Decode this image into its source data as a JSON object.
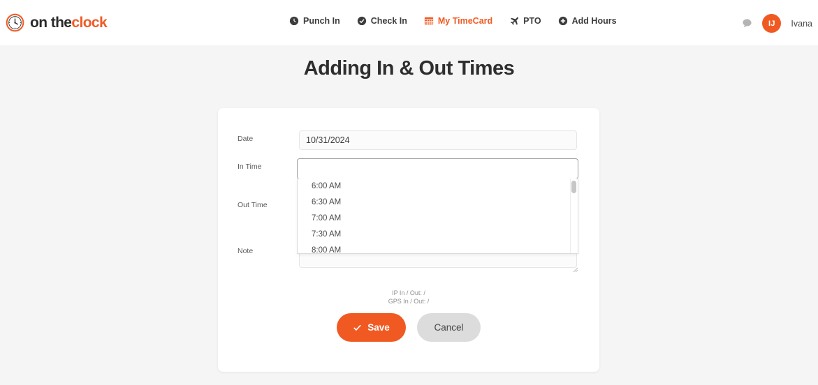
{
  "brand": {
    "icon": "clock-icon",
    "text_dark": "on the",
    "text_accent": "clock",
    "accent_color": "#ef5b25"
  },
  "nav": {
    "items": [
      {
        "label": "Punch In",
        "icon": "clock-icon",
        "active": false
      },
      {
        "label": "Check In",
        "icon": "check-circle-icon",
        "active": false
      },
      {
        "label": "My TimeCard",
        "icon": "table-grid-icon",
        "active": true
      },
      {
        "label": "PTO",
        "icon": "airplane-icon",
        "active": false
      },
      {
        "label": "Add Hours",
        "icon": "plus-circle-icon",
        "active": false
      }
    ]
  },
  "account": {
    "notification_icon": "chat-bubble-icon",
    "avatar_initials": "IJ",
    "avatar_color": "#f05a22",
    "user_name": "Ivana"
  },
  "page": {
    "title": "Adding In & Out Times"
  },
  "form": {
    "date": {
      "label": "Date",
      "value": "10/31/2024",
      "placeholder": ""
    },
    "in_time": {
      "label": "In Time",
      "value": "",
      "placeholder": "",
      "focused": true
    },
    "out_time": {
      "label": "Out Time",
      "value": "",
      "placeholder": ""
    },
    "note": {
      "label": "Note",
      "value": "",
      "placeholder": ""
    }
  },
  "time_dropdown": {
    "open": true,
    "options": [
      "6:00 AM",
      "6:30 AM",
      "7:00 AM",
      "7:30 AM",
      "8:00 AM"
    ]
  },
  "meta": {
    "ip_line": "IP In / Out:  /",
    "gps_line": "GPS In / Out:  /"
  },
  "buttons": {
    "save": "Save",
    "save_icon": "check-icon",
    "save_color": "#f05a22",
    "cancel": "Cancel"
  }
}
